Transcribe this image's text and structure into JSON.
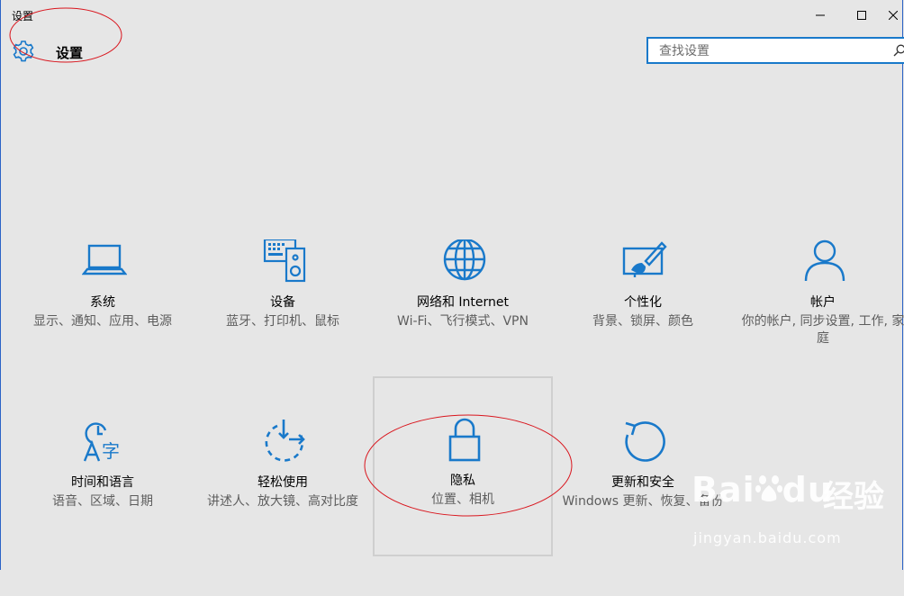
{
  "window": {
    "title": "设置",
    "controls": [
      "minimize-icon",
      "maximize-icon",
      "close-icon"
    ]
  },
  "header": {
    "icon": "gear-icon",
    "title": "设置"
  },
  "search": {
    "placeholder": "查找设置",
    "value": ""
  },
  "accent_color": "#1979ca",
  "tiles": [
    {
      "icon": "laptop-icon",
      "name": "系统",
      "desc": "显示、通知、应用、电源"
    },
    {
      "icon": "keyboard-speaker-icon",
      "name": "设备",
      "desc": "蓝牙、打印机、鼠标"
    },
    {
      "icon": "globe-icon",
      "name": "网络和 Internet",
      "desc": "Wi-Fi、飞行模式、VPN"
    },
    {
      "icon": "personalization-icon",
      "name": "个性化",
      "desc": "背景、锁屏、颜色"
    },
    {
      "icon": "person-icon",
      "name": "帐户",
      "desc": "你的帐户, 同步设置, 工作, 家庭"
    },
    {
      "icon": "time-language-icon",
      "name": "时间和语言",
      "desc": "语音、区域、日期"
    },
    {
      "icon": "ease-of-access-icon",
      "name": "轻松使用",
      "desc": "讲述人、放大镜、高对比度"
    },
    {
      "icon": "lock-icon",
      "name": "隐私",
      "desc": "位置、相机"
    },
    {
      "icon": "refresh-icon",
      "name": "更新和安全",
      "desc": "Windows 更新、恢复、备份"
    }
  ],
  "watermark": {
    "brand": "Bai",
    "brand_suffix": "du",
    "brand_cn": "经验",
    "url": "jingyan.baidu.com"
  }
}
